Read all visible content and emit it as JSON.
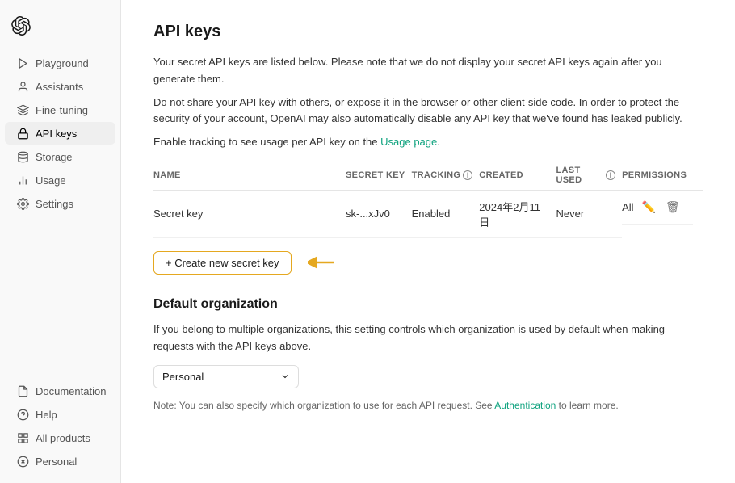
{
  "sidebar": {
    "logo_alt": "OpenAI",
    "nav_items": [
      {
        "id": "playground",
        "label": "Playground",
        "icon": "playground"
      },
      {
        "id": "assistants",
        "label": "Assistants",
        "icon": "assistants"
      },
      {
        "id": "fine-tuning",
        "label": "Fine-tuning",
        "icon": "fine-tuning"
      },
      {
        "id": "api-keys",
        "label": "API keys",
        "icon": "api-keys",
        "active": true
      },
      {
        "id": "storage",
        "label": "Storage",
        "icon": "storage"
      },
      {
        "id": "usage",
        "label": "Usage",
        "icon": "usage"
      },
      {
        "id": "settings",
        "label": "Settings",
        "icon": "settings"
      }
    ],
    "bottom_items": [
      {
        "id": "documentation",
        "label": "Documentation",
        "icon": "docs"
      },
      {
        "id": "help",
        "label": "Help",
        "icon": "help"
      },
      {
        "id": "all-products",
        "label": "All products",
        "icon": "grid"
      },
      {
        "id": "personal",
        "label": "Personal",
        "icon": "close-circle"
      }
    ]
  },
  "main": {
    "page_title": "API keys",
    "desc1": "Your secret API keys are listed below. Please note that we do not display your secret API keys again after you generate them.",
    "desc2": "Do not share your API key with others, or expose it in the browser or other client-side code. In order to protect the security of your account, OpenAI may also automatically disable any API key that we've found has leaked publicly.",
    "usage_link_prefix": "Enable tracking to see usage per API key on the ",
    "usage_link_text": "Usage page",
    "usage_link_suffix": ".",
    "table": {
      "headers": [
        "NAME",
        "SECRET KEY",
        "TRACKING",
        "CREATED",
        "LAST USED",
        "PERMISSIONS"
      ],
      "rows": [
        {
          "name": "Secret key",
          "secret_key": "sk-...xJv0",
          "tracking": "Enabled",
          "created": "2024年2月11日",
          "last_used": "Never",
          "permissions": "All"
        }
      ]
    },
    "create_button_label": "+ Create new secret key",
    "default_org": {
      "title": "Default organization",
      "desc": "If you belong to multiple organizations, this setting controls which organization is used by default when making requests with the API keys above.",
      "select_value": "Personal",
      "note_prefix": "Note: You can also specify which organization to use for each API request. See ",
      "note_link": "Authentication",
      "note_suffix": " to learn more."
    }
  }
}
